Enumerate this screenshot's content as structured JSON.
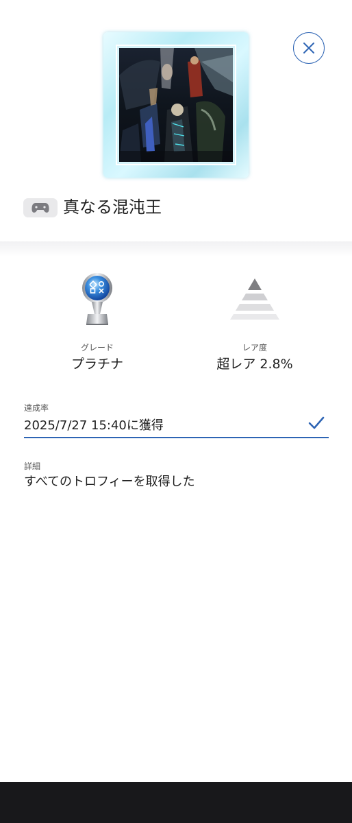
{
  "trophy": {
    "title": "真なる混沌王",
    "art_icon": "trophy-artwork"
  },
  "platform": {
    "icon": "gamepad-icon"
  },
  "close": {
    "icon": "close-icon"
  },
  "grade": {
    "label": "グレード",
    "value": "プラチナ",
    "icon": "platinum-trophy-icon"
  },
  "rarity": {
    "label": "レア度",
    "value": "超レア 2.8%",
    "icon": "rarity-pyramid-icon"
  },
  "achievement": {
    "label": "達成率",
    "value": "2025/7/27  15:40に獲得",
    "icon": "checkmark-icon"
  },
  "details": {
    "label": "詳細",
    "value": "すべてのトロフィーを取得した"
  },
  "colors": {
    "accent": "#2d64b4",
    "text": "#1f1f1f",
    "muted": "#555555",
    "bottom_bar": "#18181b"
  }
}
